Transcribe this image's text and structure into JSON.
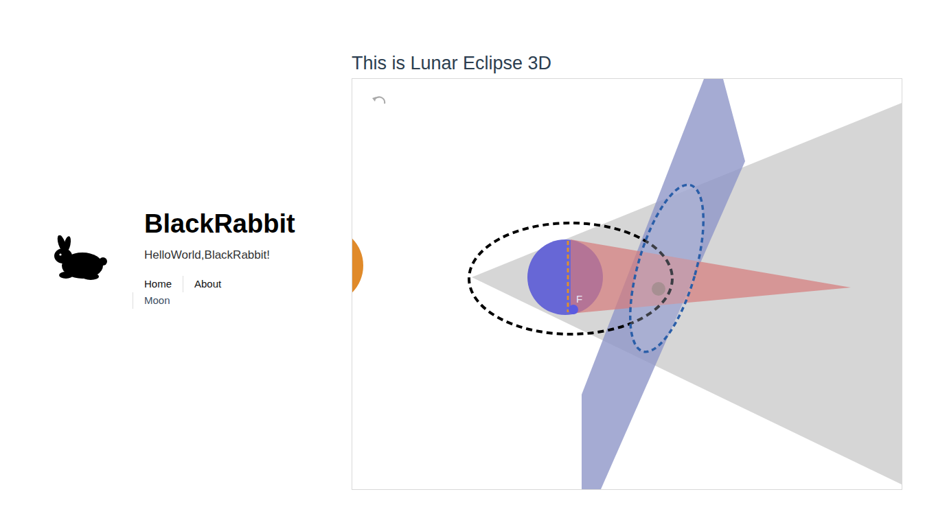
{
  "site": {
    "title": "BlackRabbit",
    "subtitle": "HelloWorld,BlackRabbit!"
  },
  "nav": [
    {
      "label": "Home",
      "selected": false
    },
    {
      "label": "About",
      "selected": false
    },
    {
      "label": "Moon",
      "selected": true
    }
  ],
  "page": {
    "heading": "This is Lunar Eclipse 3D"
  },
  "applet": {
    "point_labels": [
      "F"
    ]
  }
}
